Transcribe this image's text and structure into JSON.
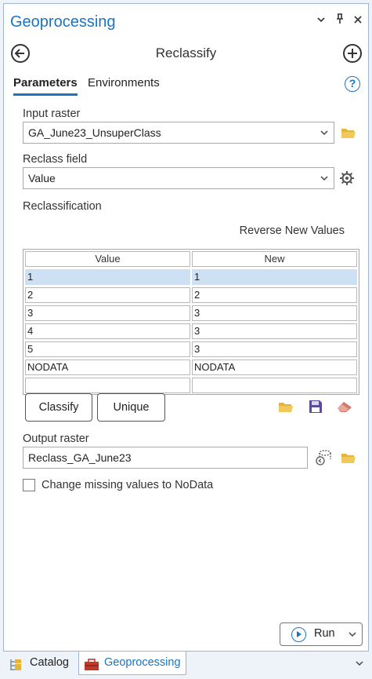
{
  "window": {
    "title": "Geoprocessing"
  },
  "header": {
    "tool_title": "Reclassify"
  },
  "tabs": [
    {
      "label": "Parameters",
      "active": true
    },
    {
      "label": "Environments",
      "active": false
    }
  ],
  "params": {
    "input_raster_label": "Input raster",
    "input_raster_value": "GA_June23_UnsuperClass",
    "reclass_field_label": "Reclass field",
    "reclass_field_value": "Value",
    "reclassification_label": "Reclassification",
    "reverse_label": "Reverse New Values",
    "output_raster_label": "Output raster",
    "output_raster_value": "Reclass_GA_June23",
    "missing_values_label": "Change missing values to NoData",
    "missing_values_checked": false
  },
  "table": {
    "columns": [
      "Value",
      "New"
    ],
    "rows": [
      [
        "1",
        "1"
      ],
      [
        "2",
        "2"
      ],
      [
        "3",
        "3"
      ],
      [
        "4",
        "3"
      ],
      [
        "5",
        "3"
      ],
      [
        "NODATA",
        "NODATA"
      ],
      [
        "",
        ""
      ]
    ],
    "selected_row": 0
  },
  "buttons": {
    "classify": "Classify",
    "unique": "Unique",
    "run": "Run"
  },
  "bottom_tabs": [
    {
      "label": "Catalog",
      "active": false
    },
    {
      "label": "Geoprocessing",
      "active": true
    }
  ],
  "colors": {
    "accent": "#1a74c4",
    "folder": "#e3b53a",
    "save": "#5b4aa0",
    "eraser": "#d4776a",
    "selected_row": "#cde0f4"
  },
  "icons": {
    "back": "back-arrow-icon",
    "add": "plus-circle-icon",
    "help": "help-icon",
    "browse": "folder-icon",
    "field_settings": "gear-icon",
    "load": "folder-open-icon",
    "save": "save-icon",
    "clear": "eraser-icon",
    "output_options": "database-options-icon",
    "run": "play-icon"
  }
}
